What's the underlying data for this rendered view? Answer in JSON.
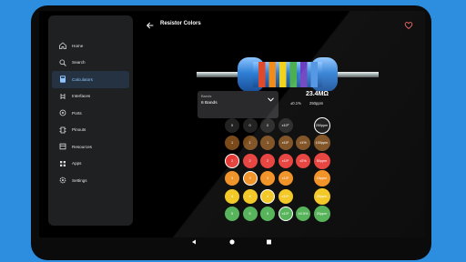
{
  "sidebar": {
    "items": [
      {
        "label": "Home",
        "icon": "home-icon",
        "active": false
      },
      {
        "label": "Search",
        "icon": "search-icon",
        "active": false
      },
      {
        "label": "Calculators",
        "icon": "calculator-icon",
        "active": true
      },
      {
        "label": "Interfaces",
        "icon": "interfaces-icon",
        "active": false
      },
      {
        "label": "Ports",
        "icon": "ports-icon",
        "active": false
      },
      {
        "label": "Pinouts",
        "icon": "pinouts-icon",
        "active": false
      },
      {
        "label": "Resources",
        "icon": "resources-icon",
        "active": false
      },
      {
        "label": "Apps",
        "icon": "apps-icon",
        "active": false
      },
      {
        "label": "Settings",
        "icon": "settings-icon",
        "active": false
      }
    ]
  },
  "header": {
    "title": "Resistor Colors"
  },
  "bands_select": {
    "label": "Bands",
    "value": "6 Bands"
  },
  "result": {
    "value": "23.4MΩ",
    "tolerance": "±0.1%",
    "temp_coeff": "250ppm"
  },
  "colors": {
    "accent": "#2d8ee0",
    "heart": "#f06060",
    "active_nav": "#243241"
  },
  "resistor_bands": [
    "#e04a2a",
    "#f08c1a",
    "#f2d31a",
    "#4caf50",
    "#6a3fc0",
    "#4a90e2"
  ],
  "grid": {
    "rows": [
      [
        {
          "text": "0",
          "bg": "#222",
          "fg": "#fff"
        },
        {
          "text": "0",
          "bg": "#222",
          "fg": "#fff"
        },
        {
          "text": "0",
          "bg": "#222",
          "fg": "#fff"
        },
        {
          "text": "x10⁰",
          "bg": "#222",
          "fg": "#fff"
        },
        {
          "text": "",
          "bg": "#000",
          "fg": "#fff"
        },
        {
          "text": "250ppm",
          "bg": "#111",
          "fg": "#fff",
          "selected": true
        }
      ],
      [
        {
          "text": "1",
          "bg": "#7a4a1a",
          "fg": "#fff"
        },
        {
          "text": "1",
          "bg": "#7a4a1a",
          "fg": "#fff"
        },
        {
          "text": "1",
          "bg": "#7a4a1a",
          "fg": "#fff"
        },
        {
          "text": "x10¹",
          "bg": "#7a4a1a",
          "fg": "#fff"
        },
        {
          "text": "±1%",
          "bg": "#7a4a1a",
          "fg": "#fff"
        },
        {
          "text": "100ppm",
          "bg": "#7a4a1a",
          "fg": "#fff"
        }
      ],
      [
        {
          "text": "2",
          "bg": "#e53935",
          "fg": "#fff",
          "selected": true
        },
        {
          "text": "2",
          "bg": "#e53935",
          "fg": "#fff"
        },
        {
          "text": "2",
          "bg": "#e53935",
          "fg": "#fff"
        },
        {
          "text": "x10²",
          "bg": "#e53935",
          "fg": "#fff"
        },
        {
          "text": "±2%",
          "bg": "#e53935",
          "fg": "#fff"
        },
        {
          "text": "50ppm",
          "bg": "#e53935",
          "fg": "#fff"
        }
      ],
      [
        {
          "text": "3",
          "bg": "#f08c1a",
          "fg": "#fff"
        },
        {
          "text": "3",
          "bg": "#f08c1a",
          "fg": "#fff",
          "selected": true
        },
        {
          "text": "3",
          "bg": "#f08c1a",
          "fg": "#fff"
        },
        {
          "text": "x10³",
          "bg": "#f08c1a",
          "fg": "#fff"
        },
        {
          "text": "",
          "bg": "#000",
          "fg": "#fff"
        },
        {
          "text": "15ppm",
          "bg": "#f08c1a",
          "fg": "#fff"
        }
      ],
      [
        {
          "text": "4",
          "bg": "#f2c51a",
          "fg": "#fff"
        },
        {
          "text": "4",
          "bg": "#f2c51a",
          "fg": "#fff"
        },
        {
          "text": "4",
          "bg": "#f2c51a",
          "fg": "#fff",
          "selected": true
        },
        {
          "text": "x10⁴",
          "bg": "#f2c51a",
          "fg": "#fff"
        },
        {
          "text": "",
          "bg": "#000",
          "fg": "#fff"
        },
        {
          "text": "25ppm",
          "bg": "#f2c51a",
          "fg": "#fff"
        }
      ],
      [
        {
          "text": "5",
          "bg": "#4caf50",
          "fg": "#fff"
        },
        {
          "text": "5",
          "bg": "#4caf50",
          "fg": "#fff"
        },
        {
          "text": "5",
          "bg": "#4caf50",
          "fg": "#fff"
        },
        {
          "text": "x10⁵",
          "bg": "#4caf50",
          "fg": "#fff",
          "selected": true
        },
        {
          "text": "±0.5%",
          "bg": "#4caf50",
          "fg": "#fff"
        },
        {
          "text": "20ppm",
          "bg": "#4caf50",
          "fg": "#fff"
        }
      ]
    ]
  },
  "system_nav": [
    "back-icon",
    "home-circle-icon",
    "recents-icon"
  ]
}
